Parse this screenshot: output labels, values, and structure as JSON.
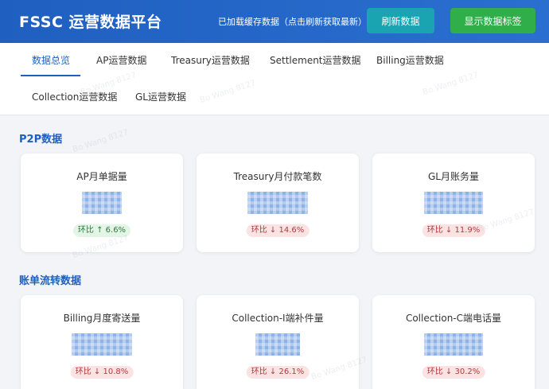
{
  "header": {
    "title": "FSSC 运营数据平台",
    "cache_note": "已加载缓存数据（点击刷新获取最新）",
    "refresh_label": "刷新数据",
    "labels_label": "显示数据标签",
    "color": "#1f5fc0"
  },
  "tabs": [
    {
      "label": "数据总览",
      "active": true
    },
    {
      "label": "AP运营数据"
    },
    {
      "label": "Treasury运营数据"
    },
    {
      "label": "Settlement运营数据"
    },
    {
      "label": "Billing运营数据"
    },
    {
      "label": "Collection运营数据"
    },
    {
      "label": "GL运营数据"
    }
  ],
  "sections": [
    {
      "title": "P2P数据",
      "cards": [
        {
          "title": "AP月单据量",
          "value": "",
          "badge": "环比 ↑ 6.6%",
          "trend": "up"
        },
        {
          "title": "Treasury月付款笔数",
          "value": "",
          "badge": "环比 ↓ 14.6%",
          "trend": "down"
        },
        {
          "title": "GL月账务量",
          "value": "",
          "badge": "环比 ↓ 11.9%",
          "trend": "down"
        }
      ]
    },
    {
      "title": "账单流转数据",
      "cards": [
        {
          "title": "Billing月度寄送量",
          "value": "",
          "badge": "环比 ↓ 10.8%",
          "trend": "down"
        },
        {
          "title": "Collection-I端补件量",
          "value": "",
          "badge": "环比 ↓ 26.1%",
          "trend": "down"
        },
        {
          "title": "Collection-C端电话量",
          "value": "",
          "badge": "环比 ↓ 30.2%",
          "trend": "down"
        }
      ]
    }
  ],
  "watermark": "Bo Wang 8127"
}
